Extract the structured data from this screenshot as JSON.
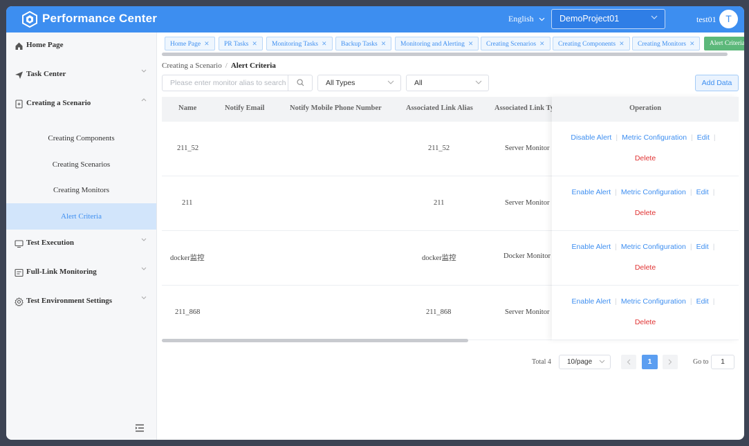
{
  "header": {
    "brand": "Performance Center",
    "language": "English",
    "project": "DemoProject01",
    "username": "test01",
    "avatar_letter": "T"
  },
  "sidebar": {
    "home": "Home Page",
    "task_center": "Task Center",
    "creating_scenario": "Creating a Scenario",
    "sub_items": [
      "Creating Components",
      "Creating Scenarios",
      "Creating Monitors",
      "Alert Criteria"
    ],
    "test_execution": "Test Execution",
    "full_link": "Full-Link Monitoring",
    "test_env": "Test Environment Settings"
  },
  "tags": [
    {
      "label": "Home Page"
    },
    {
      "label": "PR Tasks"
    },
    {
      "label": "Monitoring Tasks"
    },
    {
      "label": "Backup Tasks"
    },
    {
      "label": "Monitoring and Alerting"
    },
    {
      "label": "Creating Scenarios"
    },
    {
      "label": "Creating Components"
    },
    {
      "label": "Creating Monitors"
    },
    {
      "label": "Alert Criteria"
    }
  ],
  "breadcrumb": {
    "parent": "Creating a Scenario",
    "separator": "/",
    "current": "Alert Criteria"
  },
  "filters": {
    "search_placeholder": "Please enter monitor alias to search",
    "type_select": "All Types",
    "status_select": "All",
    "add_button": "Add Data"
  },
  "table": {
    "columns": {
      "name": "Name",
      "email": "Notify Email",
      "phone": "Notify Mobile Phone Number",
      "alias": "Associated Link Alias",
      "type": "Associated Link Ty",
      "operation": "Operation"
    },
    "rows": [
      {
        "name": "211_52",
        "alias": "211_52",
        "type": "Server Monitor",
        "toggle": "Disable Alert"
      },
      {
        "name": "211",
        "alias": "211",
        "type": "Server Monitor",
        "toggle": "Enable Alert"
      },
      {
        "name": "docker监控",
        "alias": "docker监控",
        "type": "Docker Monitor",
        "toggle": "Enable Alert"
      },
      {
        "name": "211_868",
        "alias": "211_868",
        "type": "Server Monitor",
        "toggle": "Enable Alert"
      }
    ],
    "metric_label": "Metric Configuration",
    "edit_label": "Edit",
    "delete_label": "Delete"
  },
  "pagination": {
    "total": "Total 4",
    "page_size": "10/page",
    "current_page": "1",
    "goto_label": "Go to",
    "goto_value": "1"
  },
  "colors": {
    "primary": "#3d8ef0",
    "active_tag": "#5cb87a",
    "danger": "#e03131"
  }
}
